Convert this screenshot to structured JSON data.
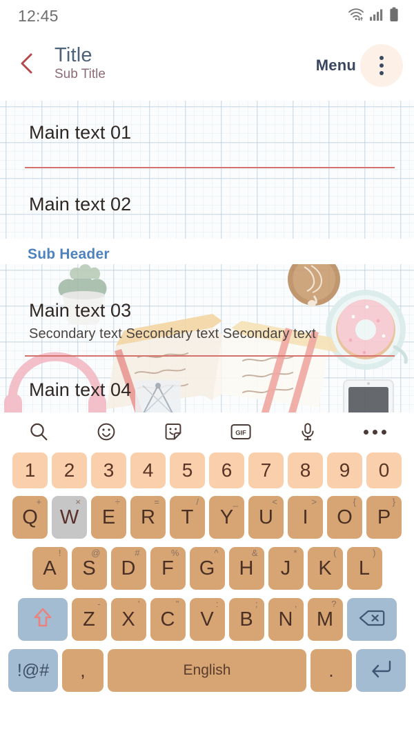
{
  "status_bar": {
    "time": "12:45",
    "icons": [
      "wifi-icon",
      "cellular-signal-icon",
      "battery-icon"
    ]
  },
  "app_bar": {
    "back_icon": "chevron-left-icon",
    "title": "Title",
    "subtitle": "Sub Title",
    "menu_label": "Menu",
    "overflow_icon": "more-vertical-icon"
  },
  "colors": {
    "title": "#4c6278",
    "subtitle": "#8d6b76",
    "menu": "#39475e",
    "back_chevron": "#b5484a",
    "sub_header": "#4d82bd",
    "divider": "#d4716d",
    "key_number": "#f9cfac",
    "key_letter": "#d7a574",
    "key_function": "#a3bcd2",
    "key_active": "#c6c6c6",
    "key_text": "#4a2f25",
    "menu_highlight": "#fdf1e7"
  },
  "content": {
    "sections": [
      {
        "items": [
          {
            "main": "Main text 01"
          },
          {
            "main": "Main text 02"
          }
        ]
      }
    ],
    "sub_header": "Sub Header",
    "items_2": [
      {
        "main": "Main text 03",
        "secondary": "Secondary text Secondary text Secondary text"
      },
      {
        "main": "Main text 04"
      }
    ]
  },
  "keyboard": {
    "toolbar": [
      {
        "name": "search-icon",
        "label": ""
      },
      {
        "name": "emoji-icon",
        "label": ""
      },
      {
        "name": "sticker-icon",
        "label": ""
      },
      {
        "name": "gif-icon",
        "label": "GIF"
      },
      {
        "name": "microphone-icon",
        "label": ""
      },
      {
        "name": "more-horizontal-icon",
        "label": ""
      }
    ],
    "number_row": [
      "1",
      "2",
      "3",
      "4",
      "5",
      "6",
      "7",
      "8",
      "9",
      "0"
    ],
    "row1": [
      {
        "key": "Q",
        "sup": "+"
      },
      {
        "key": "W",
        "sup": "×",
        "active": true
      },
      {
        "key": "E",
        "sup": "÷"
      },
      {
        "key": "R",
        "sup": "="
      },
      {
        "key": "T",
        "sup": "/"
      },
      {
        "key": "Y",
        "sup": "_"
      },
      {
        "key": "U",
        "sup": "<"
      },
      {
        "key": "I",
        "sup": ">"
      },
      {
        "key": "O",
        "sup": "{"
      },
      {
        "key": "P",
        "sup": "}"
      }
    ],
    "row2": [
      {
        "key": "A",
        "sup": "!"
      },
      {
        "key": "S",
        "sup": "@"
      },
      {
        "key": "D",
        "sup": "#"
      },
      {
        "key": "F",
        "sup": "%"
      },
      {
        "key": "G",
        "sup": "^"
      },
      {
        "key": "H",
        "sup": "&"
      },
      {
        "key": "J",
        "sup": "*"
      },
      {
        "key": "K",
        "sup": "("
      },
      {
        "key": "L",
        "sup": ")"
      }
    ],
    "row3": {
      "shift": "shift-icon",
      "keys": [
        {
          "key": "Z",
          "sup": "-"
        },
        {
          "key": "X",
          "sup": "'"
        },
        {
          "key": "C",
          "sup": "\""
        },
        {
          "key": "V",
          "sup": ":"
        },
        {
          "key": "B",
          "sup": ";"
        },
        {
          "key": "N",
          "sup": ","
        },
        {
          "key": "M",
          "sup": "?"
        }
      ],
      "backspace": "backspace-icon"
    },
    "row4": {
      "symbols_label": "!@#",
      "comma": ",",
      "space_label": "English",
      "period": ".",
      "enter": "enter-icon"
    }
  }
}
